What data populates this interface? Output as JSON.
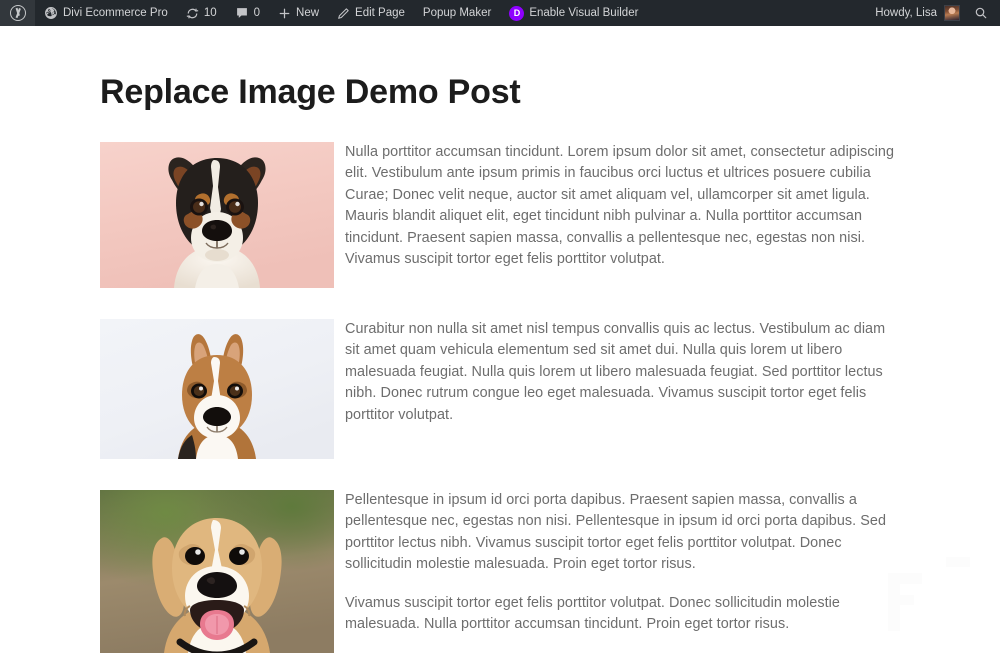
{
  "adminbar": {
    "wp_logo_name": "wordpress-logo-icon",
    "site_name": "Divi Ecommerce Pro",
    "site_icon": "dashboard-site-icon",
    "updates_icon": "updates-refresh-icon",
    "updates_count": "10",
    "comments_icon": "comment-bubble-icon",
    "comments_count": "0",
    "new_icon": "plus-icon",
    "new_label": "New",
    "edit_icon": "pencil-icon",
    "edit_label": "Edit Page",
    "popup_maker_label": "Popup Maker",
    "divi_icon": "divi-logo-icon",
    "visual_builder_label": "Enable Visual Builder",
    "howdy_label": "Howdy, Lisa",
    "avatar_name": "user-avatar",
    "search_icon": "search-icon",
    "bar_bg": "#23282d",
    "divi_accent": "#8f00ff"
  },
  "post": {
    "title": "Replace Image Demo Post",
    "sections": [
      {
        "image_name": "jack-russell-terrier-photo",
        "image_alt": "Jack Russell terrier portrait on pink background",
        "paragraphs": [
          "Nulla porttitor accumsan tincidunt. Lorem ipsum dolor sit amet, consectetur adipiscing elit. Vestibulum ante ipsum primis in faucibus orci luctus et ultrices posuere cubilia Curae; Donec velit neque, auctor sit amet aliquam vel, ullamcorper sit amet ligula. Mauris blandit aliquet elit, eget tincidunt nibh pulvinar a. Nulla porttitor accumsan tincidunt. Praesent sapien massa, convallis a pellentesque nec, egestas non nisi. Vivamus suscipit tortor eget felis porttitor volutpat."
        ]
      },
      {
        "image_name": "corgi-photo",
        "image_alt": "Corgi portrait on light background",
        "paragraphs": [
          "Curabitur non nulla sit amet nisl tempus convallis quis ac lectus. Vestibulum ac diam sit amet quam vehicula elementum sed sit amet dui. Nulla quis lorem ut libero malesuada feugiat. Nulla quis lorem ut libero malesuada feugiat. Sed porttitor lectus nibh. Donec rutrum congue leo eget malesuada. Vivamus suscipit tortor eget felis porttitor volutpat."
        ]
      },
      {
        "image_name": "beagle-photo",
        "image_alt": "Smiling beagle outdoors",
        "paragraphs": [
          "Pellentesque in ipsum id orci porta dapibus. Praesent sapien massa, convallis a pellentesque nec, egestas non nisi. Pellentesque in ipsum id orci porta dapibus. Sed porttitor lectus nibh. Vivamus suscipit tortor eget felis porttitor volutpat. Donec sollicitudin molestie malesuada. Proin eget tortor risus.",
          "Vivamus suscipit tortor eget felis porttitor volutpat. Donec sollicitudin molestie malesuada. Nulla porttitor accumsan tincidunt. Proin eget tortor risus."
        ]
      }
    ]
  }
}
